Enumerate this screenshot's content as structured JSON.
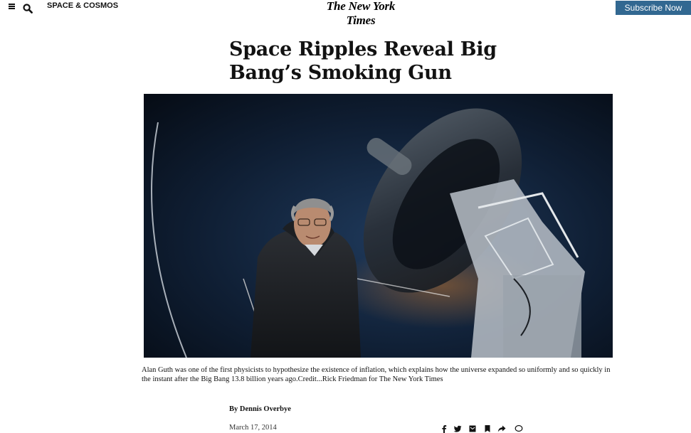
{
  "header": {
    "section": "SPACE & COSMOS",
    "masthead": "The New York Times",
    "subscribe_label": "Subscribe Now"
  },
  "article": {
    "headline": "Space Ripples Reveal Big Bang’s Smoking Gun",
    "caption": "Alan Guth was one of the first physicists to hypothesize the existence of inflation, which explains how the universe expanded so uniformly and so quickly in the instant after the Big Bang 13.8 billion years ago.",
    "credit_label": "Credit",
    "credit": "...Rick Friedman for The New York Times",
    "byline": "By Dennis Overbye",
    "date": "March 17, 2014"
  },
  "icons": {
    "menu": "menu-icon",
    "search": "search-icon",
    "share": [
      "facebook-icon",
      "twitter-icon",
      "email-icon",
      "save-icon",
      "share-icon",
      "comment-icon"
    ]
  },
  "colors": {
    "subscribe_bg": "#326891",
    "text": "#121212",
    "photo_bg": "#0b1422"
  }
}
